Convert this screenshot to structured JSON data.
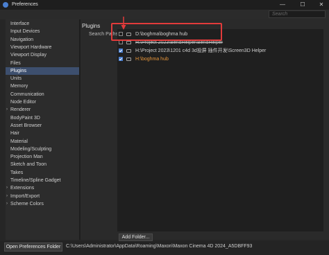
{
  "window": {
    "title": "Preferences",
    "minimize": "—",
    "maximize": "☐",
    "close": "✕"
  },
  "search": {
    "placeholder": "Search"
  },
  "sidebar": {
    "items": [
      {
        "label": "Interface",
        "expandable": false,
        "active": false
      },
      {
        "label": "Input Devices",
        "expandable": false,
        "active": false
      },
      {
        "label": "Navigation",
        "expandable": false,
        "active": false
      },
      {
        "label": "Viewport Hardware",
        "expandable": false,
        "active": false
      },
      {
        "label": "Viewport Display",
        "expandable": false,
        "active": false
      },
      {
        "label": "Files",
        "expandable": false,
        "active": false
      },
      {
        "label": "Plugins",
        "expandable": false,
        "active": true
      },
      {
        "label": "Units",
        "expandable": false,
        "active": false
      },
      {
        "label": "Memory",
        "expandable": false,
        "active": false
      },
      {
        "label": "Communication",
        "expandable": false,
        "active": false
      },
      {
        "label": "Node Editor",
        "expandable": false,
        "active": false
      },
      {
        "label": "Renderer",
        "expandable": true,
        "active": false
      },
      {
        "label": "BodyPaint 3D",
        "expandable": false,
        "active": false
      },
      {
        "label": "Asset Browser",
        "expandable": false,
        "active": false
      },
      {
        "label": "Hair",
        "expandable": false,
        "active": false
      },
      {
        "label": "Material",
        "expandable": false,
        "active": false
      },
      {
        "label": "Modeling/Sculpting",
        "expandable": false,
        "active": false
      },
      {
        "label": "Projection Man",
        "expandable": false,
        "active": false
      },
      {
        "label": "Sketch and Toon",
        "expandable": false,
        "active": false
      },
      {
        "label": "Takes",
        "expandable": false,
        "active": false
      },
      {
        "label": "Timeline/Spline Gadget",
        "expandable": false,
        "active": false
      },
      {
        "label": "Extensions",
        "expandable": true,
        "active": false
      },
      {
        "label": "Import/Export",
        "expandable": true,
        "active": false
      },
      {
        "label": "Scheme Colors",
        "expandable": true,
        "active": false
      }
    ]
  },
  "main": {
    "title": "Plugins",
    "search_paths_label": "Search Paths",
    "paths": [
      {
        "path": "D:\\boghma\\boghma hub",
        "checked": false,
        "style": "normal"
      },
      {
        "path": "H:\\Project 2023\\BendHelper\\BendHelper",
        "checked": false,
        "style": "strike"
      },
      {
        "path": "H:\\Project 2023\\1201 c4d 3d投屏 插件开发\\Screen3D Helper",
        "checked": true,
        "style": "normal"
      },
      {
        "path": "H:\\boghma hub",
        "checked": true,
        "style": "orange"
      }
    ],
    "add_folder_label": "Add Folder..."
  },
  "bottom": {
    "open_button_label": "Open Preferences Folder",
    "prefs_path": "C:\\Users\\Administrator\\AppData\\Roaming\\Maxon\\Maxon Cinema 4D 2024_A5DBFF93"
  },
  "colors": {
    "accent": "#4a7fd0",
    "selection": "#3d4f6e",
    "highlight_box": "#e23b3b",
    "orange_path": "#e6953a"
  }
}
